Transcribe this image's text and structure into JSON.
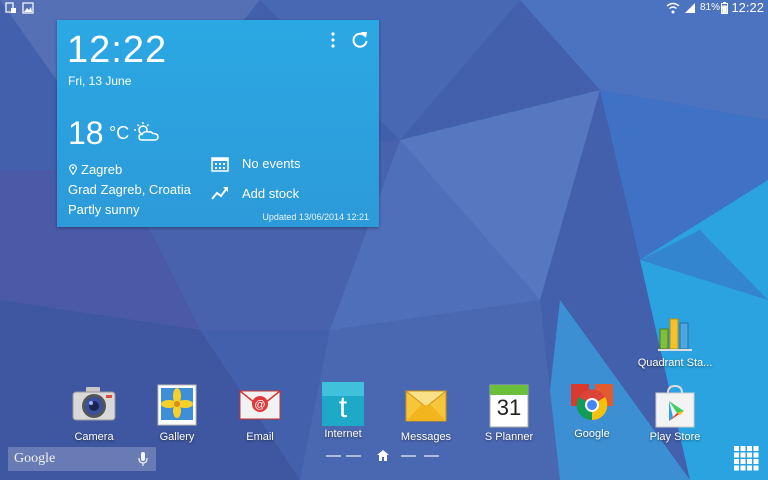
{
  "status_bar": {
    "time": "12:22",
    "battery_percent": "81%"
  },
  "widget": {
    "time": "12:22",
    "date": "Fri, 13 June",
    "temperature": "18",
    "temperature_unit": "°C",
    "city": "Zagreb",
    "region": "Grad Zagreb, Croatia",
    "condition": "Partly sunny",
    "events": "No events",
    "stock": "Add stock",
    "updated": "Updated 13/06/2014 12:21"
  },
  "apps": {
    "quadrant": "Quadrant Sta...",
    "camera": "Camera",
    "gallery": "Gallery",
    "email": "Email",
    "internet": "Internet",
    "messages": "Messages",
    "splanner": "S Planner",
    "splanner_day": "31",
    "google": "Google",
    "playstore": "Play Store"
  },
  "search": {
    "logo": "Google"
  },
  "colors": {
    "widget_bg": "#2ba8e3",
    "wallpaper_base": "#3f5ea8"
  }
}
